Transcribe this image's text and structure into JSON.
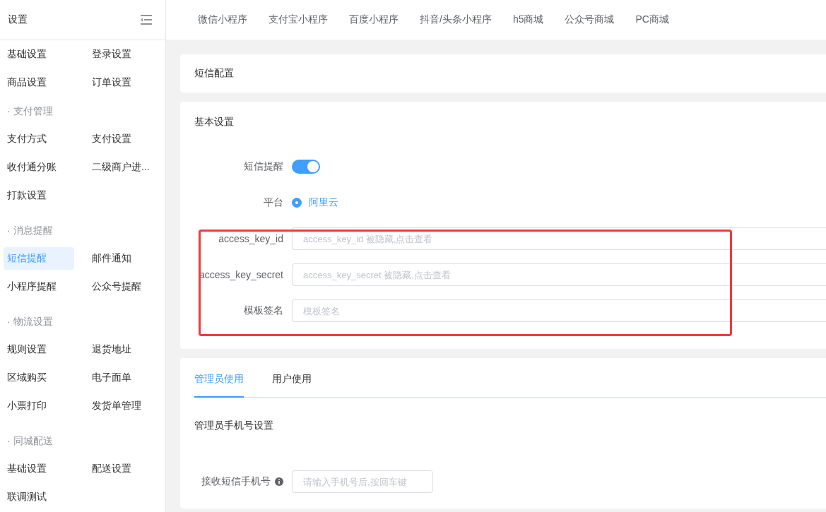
{
  "sidebar": {
    "title": "设置",
    "sections": [
      {
        "items": [
          {
            "label": "基础设置",
            "selected": false
          },
          {
            "label": "登录设置",
            "selected": false
          },
          {
            "label": "商品设置",
            "selected": false
          },
          {
            "label": "订单设置",
            "selected": false
          }
        ]
      },
      {
        "title": "· 支付管理",
        "items": [
          {
            "label": "支付方式",
            "selected": false
          },
          {
            "label": "支付设置",
            "selected": false
          },
          {
            "label": "收付通分账",
            "selected": false
          },
          {
            "label": "二级商户进...",
            "selected": false
          },
          {
            "label": "打款设置",
            "selected": false
          }
        ]
      },
      {
        "title": "· 消息提醒",
        "items": [
          {
            "label": "短信提醒",
            "selected": true
          },
          {
            "label": "邮件通知",
            "selected": false
          },
          {
            "label": "小程序提醒",
            "selected": false
          },
          {
            "label": "公众号提醒",
            "selected": false
          }
        ]
      },
      {
        "title": "· 物流设置",
        "items": [
          {
            "label": "规则设置",
            "selected": false
          },
          {
            "label": "退货地址",
            "selected": false
          },
          {
            "label": "区域购买",
            "selected": false
          },
          {
            "label": "电子面单",
            "selected": false
          },
          {
            "label": "小票打印",
            "selected": false
          },
          {
            "label": "发货单管理",
            "selected": false
          }
        ]
      },
      {
        "title": "· 同城配送",
        "items": [
          {
            "label": "基础设置",
            "selected": false
          },
          {
            "label": "配送设置",
            "selected": false
          },
          {
            "label": "联调测试",
            "selected": false
          }
        ]
      }
    ]
  },
  "top_tabs": [
    "微信小程序",
    "支付宝小程序",
    "百度小程序",
    "抖音/头条小程序",
    "h5商城",
    "公众号商城",
    "PC商城"
  ],
  "sms_config": {
    "title": "短信配置"
  },
  "basic_settings": {
    "title": "基本设置",
    "fields": [
      {
        "kind": "switch",
        "label": "短信提醒",
        "on": true
      },
      {
        "kind": "radio",
        "label": "平台",
        "options": [
          {
            "label": "阿里云",
            "selected": true
          }
        ]
      },
      {
        "kind": "input",
        "label": "access_key_id",
        "placeholder": "access_key_id 被隐藏,点击查看"
      },
      {
        "kind": "input",
        "label": "access_key_secret",
        "placeholder": "access_key_secret 被隐藏,点击查看"
      },
      {
        "kind": "input",
        "label": "模板签名",
        "placeholder": "模板签名"
      }
    ]
  },
  "usage": {
    "tabs": [
      {
        "label": "管理员使用",
        "selected": true
      },
      {
        "label": "用户使用",
        "selected": false
      }
    ],
    "section_title": "管理员手机号设置",
    "field": {
      "label": "接收短信手机号",
      "placeholder": "请输入手机号后,按回车键"
    }
  }
}
